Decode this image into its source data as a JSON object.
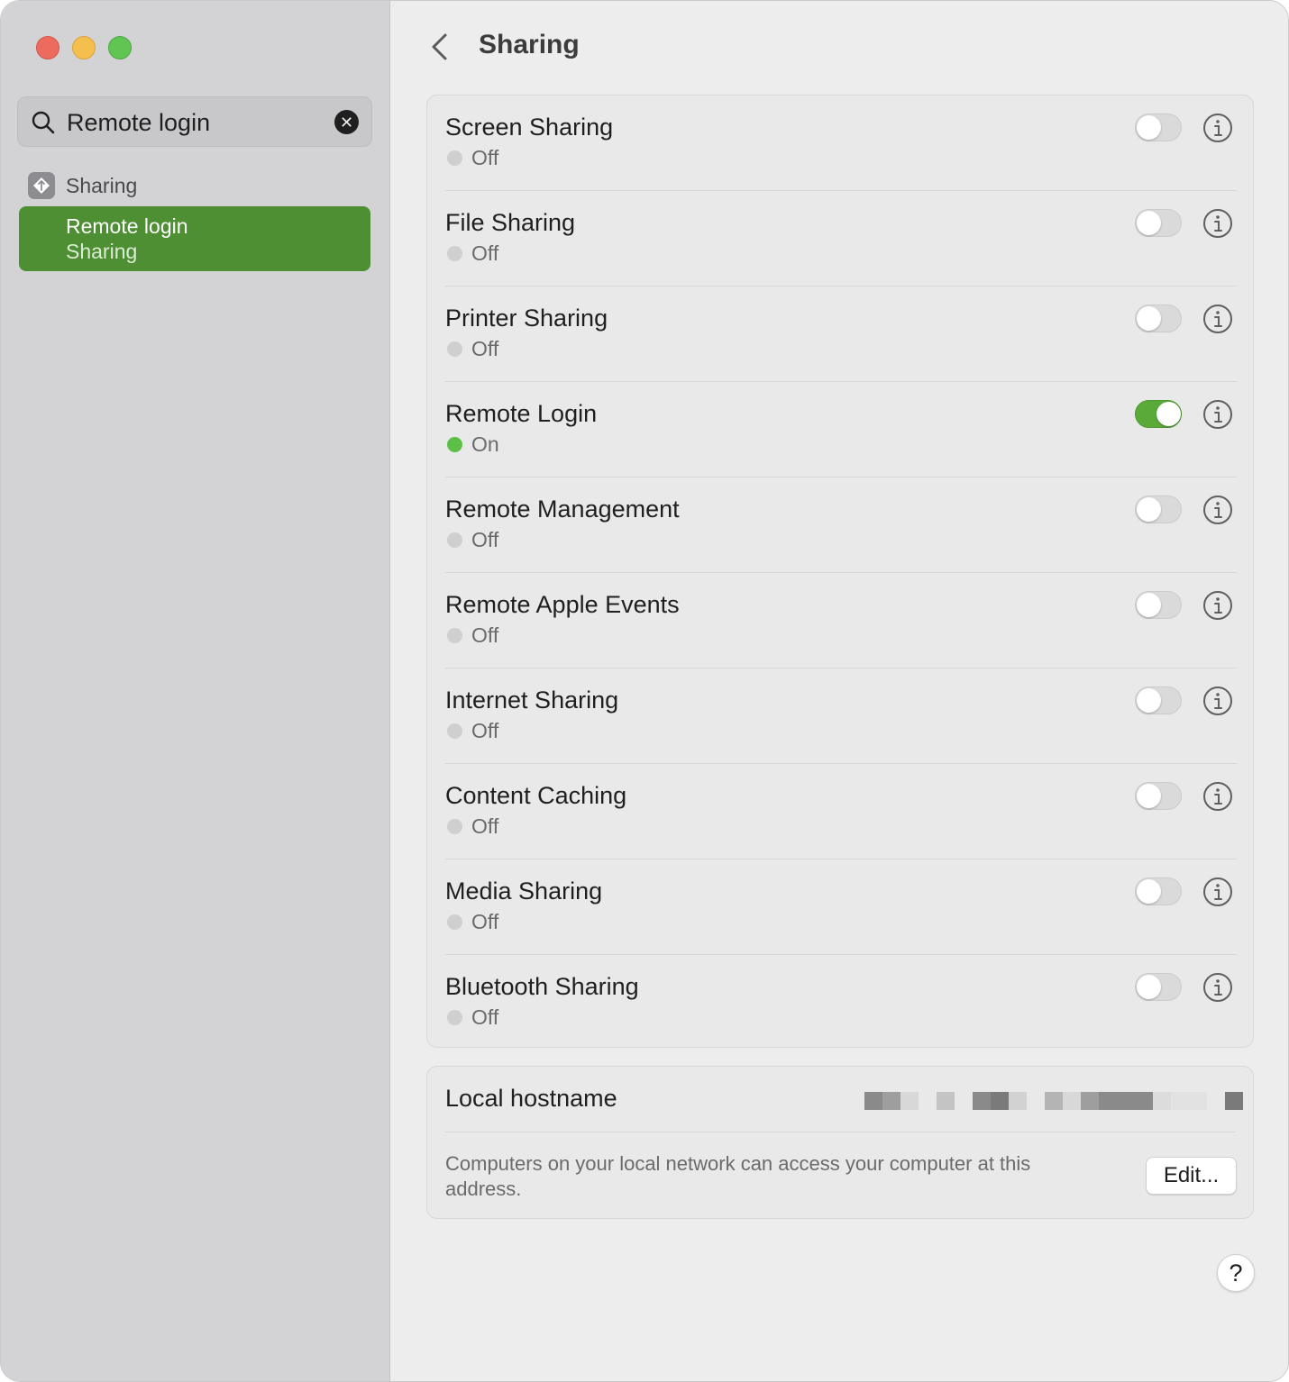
{
  "sidebar": {
    "search": {
      "value": "Remote login",
      "placeholder": "Search"
    },
    "section_label": "Sharing",
    "result": {
      "title": "Remote login",
      "subtitle": "Sharing"
    },
    "accent_color": "#4d8f32"
  },
  "header": {
    "title": "Sharing"
  },
  "services": [
    {
      "name": "Screen Sharing",
      "status": "Off",
      "enabled": false
    },
    {
      "name": "File Sharing",
      "status": "Off",
      "enabled": false
    },
    {
      "name": "Printer Sharing",
      "status": "Off",
      "enabled": false
    },
    {
      "name": "Remote Login",
      "status": "On",
      "enabled": true
    },
    {
      "name": "Remote Management",
      "status": "Off",
      "enabled": false
    },
    {
      "name": "Remote Apple Events",
      "status": "Off",
      "enabled": false
    },
    {
      "name": "Internet Sharing",
      "status": "Off",
      "enabled": false
    },
    {
      "name": "Content Caching",
      "status": "Off",
      "enabled": false
    },
    {
      "name": "Media Sharing",
      "status": "Off",
      "enabled": false
    },
    {
      "name": "Bluetooth Sharing",
      "status": "Off",
      "enabled": false
    }
  ],
  "hostname": {
    "label": "Local hostname",
    "description": "Computers on your local network can access your computer at this address.",
    "edit_label": "Edit..."
  },
  "help_label": "?",
  "icons": {
    "back": "chevron-left-icon",
    "search": "search-icon",
    "clear": "clear-icon",
    "info": "info-icon",
    "sharing": "sharing-icon"
  }
}
